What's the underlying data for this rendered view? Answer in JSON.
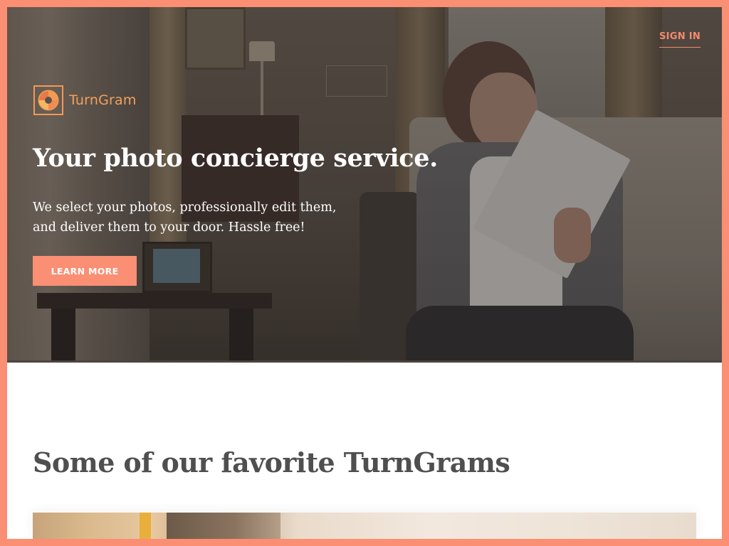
{
  "header": {
    "sign_in_label": "SIGN IN"
  },
  "brand": {
    "name": "TurnGram",
    "logo_icon": "spiral-aperture-icon",
    "accent_color": "#fa8f74",
    "logo_color": "#f3a15c"
  },
  "hero": {
    "title": "Your photo concierge service.",
    "subtitle_line1": "We select your photos, professionally edit them,",
    "subtitle_line2": "and deliver them to your door. Hassle free!",
    "cta_label": "LEARN MORE",
    "image_description": ""
  },
  "favorites": {
    "title": "Some of our favorite TurnGrams"
  }
}
